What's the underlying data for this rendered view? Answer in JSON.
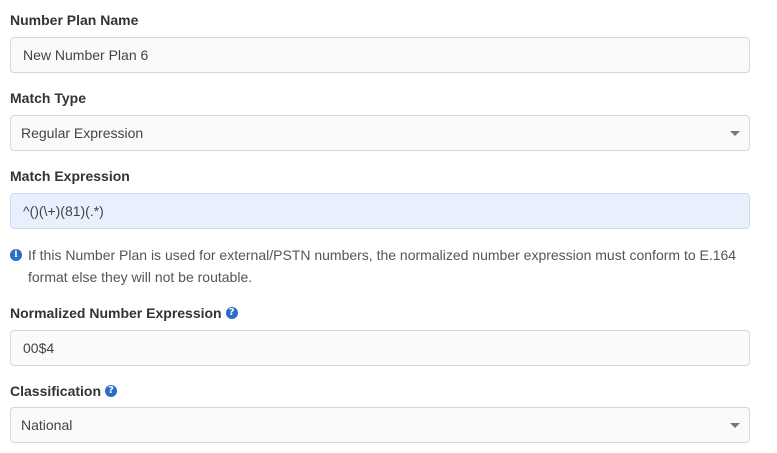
{
  "fields": {
    "number_plan_name": {
      "label": "Number Plan Name",
      "value": "New Number Plan 6"
    },
    "match_type": {
      "label": "Match Type",
      "value": "Regular Expression"
    },
    "match_expression": {
      "label": "Match Expression",
      "value": "^()(\\+)(81)(.*)"
    },
    "info_note": "If this Number Plan is used for external/PSTN numbers, the normalized number expression must conform to E.164 format else they will not be routable.",
    "normalized_expression": {
      "label": "Normalized Number Expression",
      "help_icon": "question-circle-icon",
      "value": "00$4"
    },
    "classification": {
      "label": "Classification",
      "help_icon": "question-circle-icon",
      "value": "National"
    }
  },
  "colors": {
    "accent": "#2a6cc6",
    "focused_field_bg": "#e8f0fe"
  }
}
